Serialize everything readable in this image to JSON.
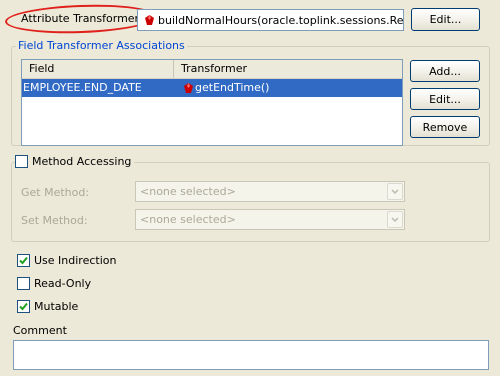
{
  "attribute_transformer": {
    "label": "Attribute Transformer:",
    "value": "buildNormalHours(oracle.toplink.sessions.Record...",
    "edit_label": "Edit..."
  },
  "field_associations": {
    "title": "Field Transformer Associations",
    "columns": [
      "Field",
      "Transformer"
    ],
    "rows": [
      {
        "field": "EMPLOYEE.END_DATE",
        "transformer": "getEndTime()",
        "selected": true
      }
    ],
    "add_label": "Add...",
    "edit_label": "Edit...",
    "remove_label": "Remove"
  },
  "method_accessing": {
    "label": "Method Accessing",
    "checked": false,
    "get_label": "Get Method:",
    "get_value": "<none selected>",
    "set_label": "Set Method:",
    "set_value": "<none selected>"
  },
  "options": [
    {
      "label": "Use Indirection",
      "checked": true
    },
    {
      "label": "Read-Only",
      "checked": false
    },
    {
      "label": "Mutable",
      "checked": true
    }
  ],
  "comment": {
    "label": "Comment",
    "value": ""
  },
  "colors": {
    "highlight_ellipse": "#e0201a",
    "selection": "#316ac5",
    "group_title": "#0046d5",
    "check": "#21a121",
    "gem": "#cc0000"
  },
  "icons": [
    "transformer-gem-icon",
    "checkmark-icon",
    "combo-arrow-icon"
  ]
}
